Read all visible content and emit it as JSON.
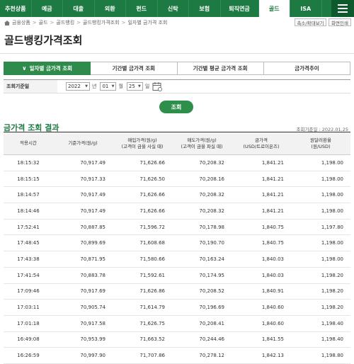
{
  "topnav": {
    "items": [
      "추천상품",
      "예금",
      "대출",
      "외환",
      "펀드",
      "신탁",
      "보험",
      "퇴직연금",
      "골드",
      "ISA"
    ],
    "active_index": 8
  },
  "breadcrumb": {
    "items": [
      "금융상품",
      "골드",
      "골드뱅킹",
      "골드뱅킹가격조회",
      "일자별 금가격 조회"
    ]
  },
  "util": {
    "zoom_label": "축소/확대보기",
    "print_label": "화면인쇄"
  },
  "page_title": "골드뱅킹가격조회",
  "tabs": [
    {
      "label": "일자별 금가격 조회",
      "active": true
    },
    {
      "label": "기간별 금가격 조회",
      "active": false
    },
    {
      "label": "기간별 평균 금가격 조회",
      "active": false
    },
    {
      "label": "금가격추이",
      "active": false
    }
  ],
  "filter": {
    "label": "조회기준일",
    "year": "2022",
    "year_unit": "년",
    "month": "01",
    "month_unit": "월",
    "day": "25",
    "day_unit": "일"
  },
  "search_button": "조회",
  "result": {
    "title": "금가격 조회 결과",
    "date_text": "조회기준일 : 2022.01.25"
  },
  "table": {
    "headers": [
      [
        "적용시간"
      ],
      [
        "기준가격(원/g)"
      ],
      [
        "매입가격(원/g)",
        "(고객이 금을 사실 때)"
      ],
      [
        "매도가격(원/g)",
        "(고객이 금을 파실 때)"
      ],
      [
        "금가격",
        "(USD/트로이온즈)"
      ],
      [
        "원달러환율",
        "(원/USD)"
      ]
    ],
    "rows": [
      [
        "18:15:32",
        "70,917.49",
        "71,626.66",
        "70,208.32",
        "1,841.21",
        "1,198.00"
      ],
      [
        "18:15:15",
        "70,917.33",
        "71,626.50",
        "70,208.16",
        "1,841.21",
        "1,198.00"
      ],
      [
        "18:14:57",
        "70,917.49",
        "71,626.66",
        "70,208.32",
        "1,841.21",
        "1,198.00"
      ],
      [
        "18:14:46",
        "70,917.49",
        "71,626.66",
        "70,208.32",
        "1,841.21",
        "1,198.00"
      ],
      [
        "17:52:41",
        "70,887.85",
        "71,596.72",
        "70,178.98",
        "1,840.75",
        "1,197.80"
      ],
      [
        "17:48:45",
        "70,899.69",
        "71,608.68",
        "70,190.70",
        "1,840.75",
        "1,198.00"
      ],
      [
        "17:43:38",
        "70,871.95",
        "71,580.66",
        "70,163.24",
        "1,840.03",
        "1,198.00"
      ],
      [
        "17:41:54",
        "70,883.78",
        "71,592.61",
        "70,174.95",
        "1,840.03",
        "1,198.20"
      ],
      [
        "17:09:46",
        "70,917.69",
        "71,626.86",
        "70,208.52",
        "1,840.91",
        "1,198.20"
      ],
      [
        "17:03:11",
        "70,905.74",
        "71,614.79",
        "70,196.69",
        "1,840.60",
        "1,198.20"
      ],
      [
        "17:01:18",
        "70,917.58",
        "71,626.75",
        "70,208.41",
        "1,840.60",
        "1,198.40"
      ],
      [
        "16:49:08",
        "70,953.99",
        "71,663.52",
        "70,244.46",
        "1,841.55",
        "1,198.40"
      ],
      [
        "16:26:59",
        "70,997.90",
        "71,707.86",
        "70,278.12",
        "1,842.13",
        "1,198.80"
      ]
    ]
  }
}
